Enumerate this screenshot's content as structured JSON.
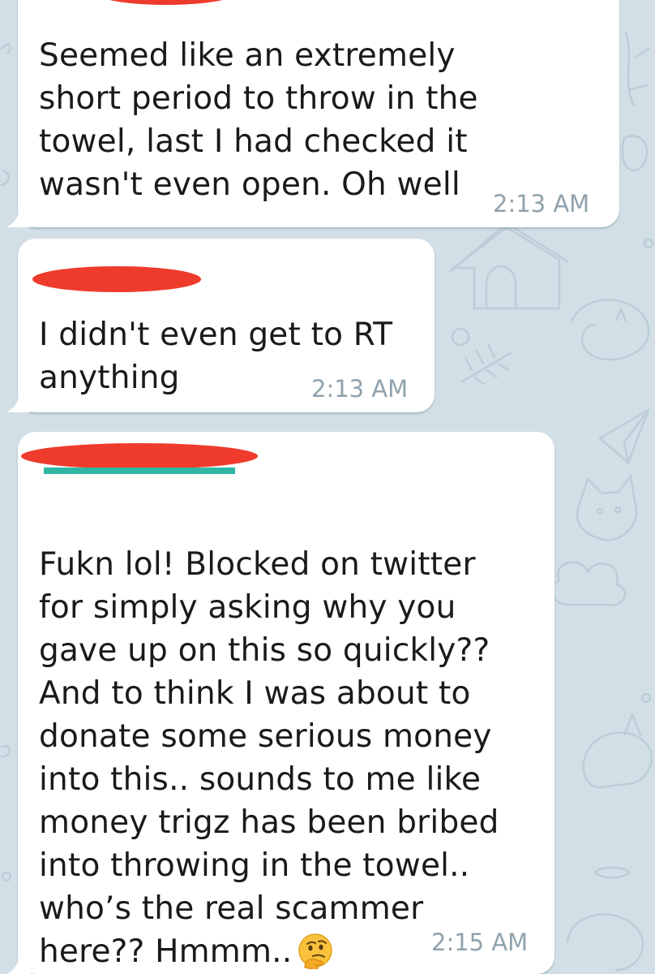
{
  "messages": [
    {
      "sender_redacted": true,
      "text": "Seemed like an extremely\nshort period to throw in the\ntowel, last I had checked it\nwasn't even open. Oh well",
      "time": "2:13 AM"
    },
    {
      "sender_redacted": true,
      "text": "I didn't even get to RT\nanything",
      "time": "2:13 AM"
    },
    {
      "sender_redacted": true,
      "text": "Fukn lol! Blocked on twitter\nfor simply asking why you\ngave up on this so quickly??\nAnd to think I was about to\ndonate some serious money\ninto this.. sounds to me like\nmoney trigz has been bribed\ninto throwing in the towel..\nwho’s the real scammer\nhere?? Hmmm..",
      "emoji": "thinking-face",
      "time": "2:15 AM"
    }
  ],
  "colors": {
    "chat_background": "#d2dfe6",
    "bubble": "#ffffff",
    "timestamp": "#8fa2ad",
    "redaction": "#ee3b2c"
  }
}
